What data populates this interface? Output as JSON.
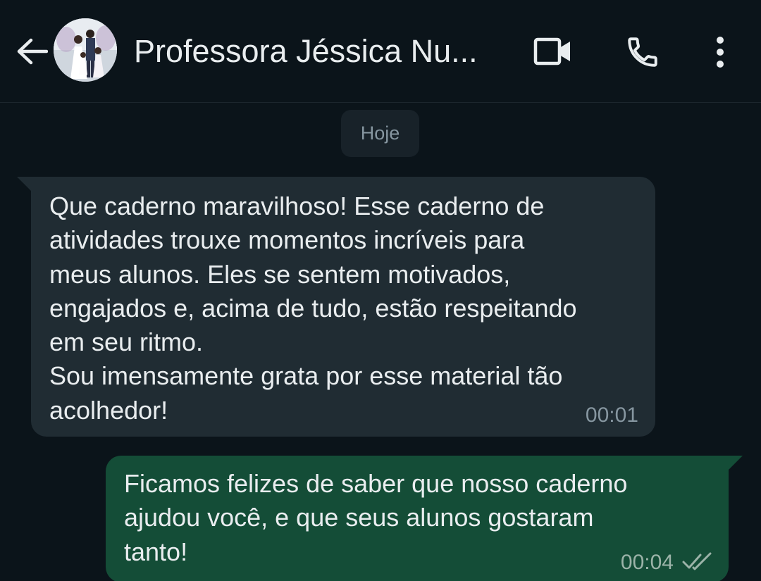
{
  "header": {
    "contact_name": "Professora Jéssica Nu...",
    "icons": [
      "back-arrow-icon",
      "video-call-icon",
      "phone-icon",
      "more-vert-icon"
    ]
  },
  "date_chip": "Hoje",
  "messages": [
    {
      "direction": "incoming",
      "text": "Que caderno maravilhoso! Esse caderno de\natividades trouxe momentos incríveis para\nmeus alunos. Eles se sentem motivados,\nengajados e, acima de tudo, estão respeitando\nem seu ritmo.\nSou imensamente grata por esse material tão\nacolhedor!",
      "time": "00:01"
    },
    {
      "direction": "outgoing",
      "text": "Ficamos felizes de saber que nosso caderno\najudou você, e que seus alunos gostaram\ntanto!",
      "time": "00:04",
      "status": "read-ticks"
    }
  ],
  "colors": {
    "background": "#0b141a",
    "incoming_bubble": "#202c33",
    "outgoing_bubble": "#144d37",
    "text": "#e9edef",
    "meta_text": "#8696a0"
  }
}
